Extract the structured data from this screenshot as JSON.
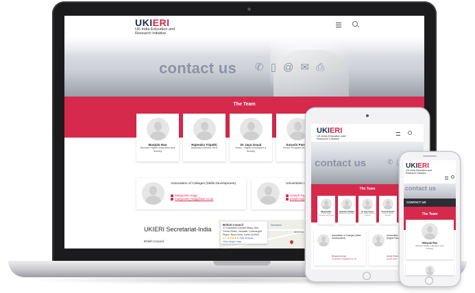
{
  "brand": {
    "mark_a": "UKI",
    "mark_b": "ERI",
    "tagline": "UK-India Education and Research Initiative"
  },
  "hero": {
    "headline": "contact us",
    "icons": "✆ ▯ @ ✉ ⎙"
  },
  "team": {
    "title": "The Team",
    "members": [
      {
        "name": "Manjula Rao",
        "role": "Director Higher education and Society"
      },
      {
        "name": "Rajendra Tripathi",
        "role": "Assistant Director HES"
      },
      {
        "name": "Dr Jaya Goyal",
        "role": "Head - Higher Education & Society"
      },
      {
        "name": "Suruchi Pareek",
        "role": "Senior Program Manager"
      }
    ]
  },
  "orgs": [
    {
      "name": "Association of Colleges (Skills Development)",
      "person": "Marguerite Hogg",
      "email": "marguerite_hogg@aoc.co.uk"
    },
    {
      "name": "Universities UK International (Higher Education)",
      "person": "Joseph Taylor",
      "email": "joseph.taylor"
    }
  ],
  "secretariat": {
    "title": "UKIERI Secretariat-India",
    "line1": "British Council"
  },
  "map": {
    "place": "British Council",
    "address": "17 Kasturba Gandhi Marg, Atul Grove Road, Janpath, Connaught Place, New Delhi, Delhi 110001",
    "rating": "4.4 ★★★★★",
    "reviews": "296 reviews",
    "link": "View larger map",
    "label_a": "Directions",
    "label_b": "American"
  },
  "tablet": {
    "team_title": "The Team"
  },
  "phone": {
    "contact_bar": "CONTACT US",
    "team_title": "The Team"
  },
  "colors": {
    "brand_red": "#d62a4d",
    "brand_navy": "#1d2d4a"
  }
}
